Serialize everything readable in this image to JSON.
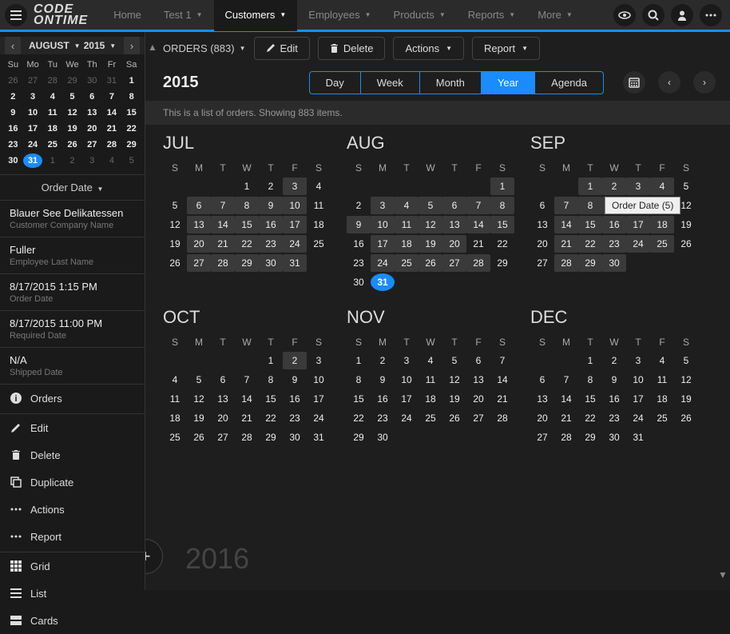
{
  "logo": {
    "line1": "CODE",
    "line2": "ONTIME"
  },
  "nav": {
    "items": [
      {
        "label": "Home",
        "has_caret": false,
        "active": false
      },
      {
        "label": "Test 1",
        "has_caret": true,
        "active": false
      },
      {
        "label": "Customers",
        "has_caret": true,
        "active": true
      },
      {
        "label": "Employees",
        "has_caret": true,
        "active": false
      },
      {
        "label": "Products",
        "has_caret": true,
        "active": false
      },
      {
        "label": "Reports",
        "has_caret": true,
        "active": false
      },
      {
        "label": "More",
        "has_caret": true,
        "active": false
      }
    ]
  },
  "sidebar": {
    "mini_cal": {
      "month_label": "AUGUST",
      "year_label": "2015",
      "dow": [
        "Su",
        "Mo",
        "Tu",
        "We",
        "Th",
        "Fr",
        "Sa"
      ],
      "rows": [
        [
          {
            "d": "26",
            "in": false
          },
          {
            "d": "27",
            "in": false
          },
          {
            "d": "28",
            "in": false
          },
          {
            "d": "29",
            "in": false
          },
          {
            "d": "30",
            "in": false
          },
          {
            "d": "31",
            "in": false
          },
          {
            "d": "1",
            "in": true
          }
        ],
        [
          {
            "d": "2",
            "in": true
          },
          {
            "d": "3",
            "in": true
          },
          {
            "d": "4",
            "in": true
          },
          {
            "d": "5",
            "in": true
          },
          {
            "d": "6",
            "in": true
          },
          {
            "d": "7",
            "in": true
          },
          {
            "d": "8",
            "in": true
          }
        ],
        [
          {
            "d": "9",
            "in": true
          },
          {
            "d": "10",
            "in": true
          },
          {
            "d": "11",
            "in": true
          },
          {
            "d": "12",
            "in": true
          },
          {
            "d": "13",
            "in": true
          },
          {
            "d": "14",
            "in": true
          },
          {
            "d": "15",
            "in": true
          }
        ],
        [
          {
            "d": "16",
            "in": true
          },
          {
            "d": "17",
            "in": true
          },
          {
            "d": "18",
            "in": true
          },
          {
            "d": "19",
            "in": true
          },
          {
            "d": "20",
            "in": true
          },
          {
            "d": "21",
            "in": true
          },
          {
            "d": "22",
            "in": true
          }
        ],
        [
          {
            "d": "23",
            "in": true
          },
          {
            "d": "24",
            "in": true
          },
          {
            "d": "25",
            "in": true
          },
          {
            "d": "26",
            "in": true
          },
          {
            "d": "27",
            "in": true
          },
          {
            "d": "28",
            "in": true
          },
          {
            "d": "29",
            "in": true
          }
        ],
        [
          {
            "d": "30",
            "in": true
          },
          {
            "d": "31",
            "in": true,
            "today": true
          },
          {
            "d": "1",
            "in": false
          },
          {
            "d": "2",
            "in": false
          },
          {
            "d": "3",
            "in": false
          },
          {
            "d": "4",
            "in": false
          },
          {
            "d": "5",
            "in": false
          }
        ]
      ]
    },
    "dropdown_label": "Order Date",
    "blocks": [
      {
        "value": "Blauer See Delikatessen",
        "label": "Customer Company Name"
      },
      {
        "value": "Fuller",
        "label": "Employee Last Name"
      },
      {
        "value": "8/17/2015 1:15 PM",
        "label": "Order Date"
      },
      {
        "value": "8/17/2015 11:00 PM",
        "label": "Required Date"
      },
      {
        "value": "N/A",
        "label": "Shipped Date"
      }
    ],
    "actions": [
      {
        "icon": "info",
        "label": "Orders"
      },
      {
        "icon": "edit",
        "label": "Edit"
      },
      {
        "icon": "delete",
        "label": "Delete"
      },
      {
        "icon": "duplicate",
        "label": "Duplicate"
      },
      {
        "icon": "dots",
        "label": "Actions"
      },
      {
        "icon": "dots",
        "label": "Report"
      },
      {
        "icon": "grid",
        "label": "Grid"
      },
      {
        "icon": "list",
        "label": "List"
      },
      {
        "icon": "cards",
        "label": "Cards"
      }
    ]
  },
  "content": {
    "breadcrumb": "ORDERS (883)",
    "toolbar": {
      "edit": "Edit",
      "delete": "Delete",
      "actions": "Actions",
      "report": "Report"
    },
    "year_label": "2015",
    "segments": [
      "Day",
      "Week",
      "Month",
      "Year",
      "Agenda"
    ],
    "active_segment": "Year",
    "info": "This is a list of orders. Showing 883 items.",
    "tooltip": "Order Date (5)",
    "next_year": "2016",
    "dow": [
      "S",
      "M",
      "T",
      "W",
      "T",
      "F",
      "S"
    ],
    "months_row1": [
      {
        "title": "JUL",
        "lead": 3,
        "days": 31,
        "events": [
          3,
          6,
          7,
          8,
          9,
          10,
          13,
          14,
          15,
          16,
          17,
          20,
          21,
          22,
          23,
          24,
          27,
          28,
          29,
          30,
          31
        ],
        "today": null
      },
      {
        "title": "AUG",
        "lead": 6,
        "days": 31,
        "events": [
          1,
          3,
          4,
          5,
          6,
          7,
          8,
          9,
          10,
          11,
          12,
          13,
          14,
          15,
          17,
          18,
          19,
          20,
          24,
          25,
          26,
          27,
          28
        ],
        "today": 31
      },
      {
        "title": "SEP",
        "lead": 2,
        "days": 30,
        "events": [
          1,
          2,
          3,
          4,
          7,
          8,
          9,
          10,
          11,
          14,
          15,
          16,
          17,
          18,
          21,
          22,
          23,
          24,
          25,
          28,
          29,
          30
        ],
        "today": null
      }
    ],
    "months_row2": [
      {
        "title": "OCT",
        "lead": 4,
        "days": 31,
        "events": [
          2
        ],
        "today": null
      },
      {
        "title": "NOV",
        "lead": 0,
        "days": 30,
        "events": [],
        "today": null
      },
      {
        "title": "DEC",
        "lead": 2,
        "days": 31,
        "events": [],
        "today": null
      }
    ]
  }
}
